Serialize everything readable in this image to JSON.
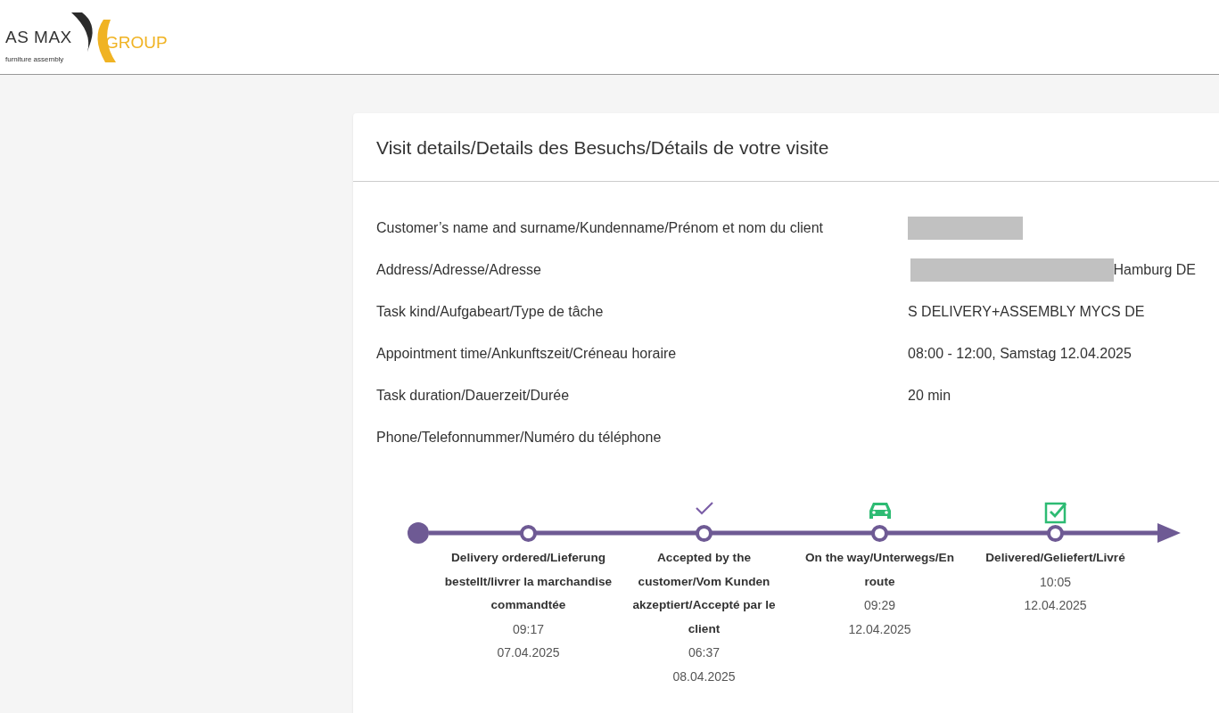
{
  "header": {
    "logo": {
      "name": "AS MAX",
      "group": "GROUP",
      "tagline": "furniture assembly"
    }
  },
  "card": {
    "title": "Visit details/Details des Besuchs/Détails de votre visite",
    "fields": [
      {
        "label": "Customer’s name and surname/Kundenname/Prénom et nom du client",
        "redacted": true
      },
      {
        "label": "Address/Adresse/Adresse",
        "redacted": true,
        "value": "Hamburg DE"
      },
      {
        "label": "Task kind/Aufgabeart/Type de tâche",
        "value": "S DELIVERY+ASSEMBLY MYCS DE"
      },
      {
        "label": "Appointment time/Ankunftszeit/Créneau horaire",
        "value": "08:00 - 12:00, Samstag 12.04.2025"
      },
      {
        "label": "Task duration/Dauerzeit/Durée",
        "value": "20 min"
      },
      {
        "label": "Phone/Telefonnummer/Numéro du téléphone"
      }
    ],
    "timeline": [
      {
        "label": "Delivery ordered/Lieferung bestellt/livrer la marchandise commandtée",
        "time": "09:17",
        "date": "07.04.2025"
      },
      {
        "label": "Accepted by the customer/Vom Kunden akzeptiert/Accepté par le client",
        "time": "06:37",
        "date": "08.04.2025",
        "kind": "check"
      },
      {
        "label": "On the way/Unterwegs/En route",
        "time": "09:29",
        "date": "12.04.2025",
        "kind": "car"
      },
      {
        "label": "Delivered/Geliefert/Livré",
        "time": "10:05",
        "date": "12.04.2025",
        "kind": "checked-box"
      }
    ]
  }
}
